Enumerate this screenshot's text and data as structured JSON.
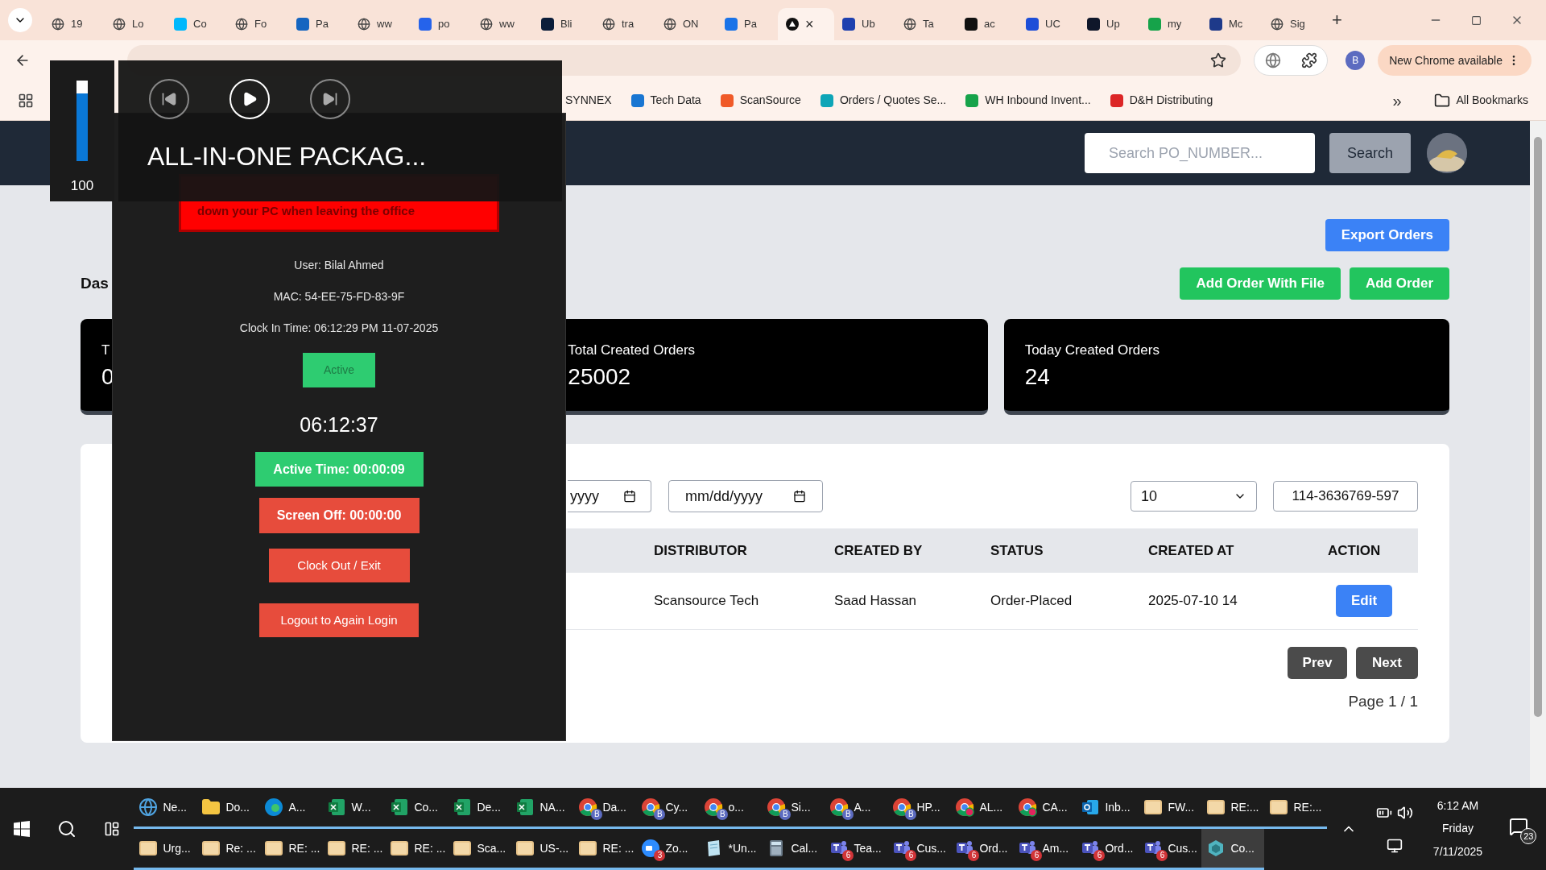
{
  "browser": {
    "tabs": [
      {
        "label": "19",
        "selected": false,
        "kind": "globe"
      },
      {
        "label": "Lo",
        "selected": false,
        "kind": "globe"
      },
      {
        "label": "Co",
        "selected": false,
        "kind": "square",
        "color": "#00b8fc"
      },
      {
        "label": "Fo",
        "selected": false,
        "kind": "globe"
      },
      {
        "label": "Pa",
        "selected": false,
        "kind": "square",
        "color": "#1565c0"
      },
      {
        "label": "ww",
        "selected": false,
        "kind": "globe"
      },
      {
        "label": "po",
        "selected": false,
        "kind": "square",
        "color": "#2563eb"
      },
      {
        "label": "ww",
        "selected": false,
        "kind": "globe"
      },
      {
        "label": "Bli",
        "selected": false,
        "kind": "square",
        "color": "#0b1d3a"
      },
      {
        "label": "tra",
        "selected": false,
        "kind": "globe"
      },
      {
        "label": "ON",
        "selected": false,
        "kind": "globe"
      },
      {
        "label": "Pa",
        "selected": false,
        "kind": "square",
        "color": "#1a73e8"
      },
      {
        "selected": true,
        "kind": "dot",
        "close": "×"
      },
      {
        "label": "Ub",
        "selected": false,
        "kind": "square",
        "color": "#1e40af"
      },
      {
        "label": "Ta",
        "selected": false,
        "kind": "globe"
      },
      {
        "label": "ac",
        "selected": false,
        "kind": "square",
        "color": "#111111"
      },
      {
        "label": "UC",
        "selected": false,
        "kind": "square",
        "color": "#1d4ed8"
      },
      {
        "label": "Up",
        "selected": false,
        "kind": "square",
        "color": "#0f172a"
      },
      {
        "label": "my",
        "selected": false,
        "kind": "square",
        "color": "#16a34a"
      },
      {
        "label": "Mc",
        "selected": false,
        "kind": "square",
        "color": "#1e3a8a"
      },
      {
        "label": "Sig",
        "selected": false,
        "kind": "globe"
      }
    ],
    "new_tab": "+",
    "profile": "B",
    "update_button": "New Chrome available",
    "bookmarks": [
      {
        "label": "SYNNEX",
        "kind": "none"
      },
      {
        "label": "Tech Data",
        "kind": "square",
        "color": "#1976d2"
      },
      {
        "label": "ScanSource",
        "kind": "square",
        "color": "#f05a28"
      },
      {
        "label": "Orders / Quotes Se...",
        "kind": "square",
        "color": "#0ea5b7"
      },
      {
        "label": "WH Inbound Invent...",
        "kind": "square",
        "color": "#16a34a"
      },
      {
        "label": "D&H Distributing",
        "kind": "square",
        "color": "#dc2626"
      }
    ],
    "more": "»",
    "all_bookmarks": "All Bookmarks"
  },
  "app": {
    "search_placeholder": "Search PO_NUMBER...",
    "search_button": "Search",
    "export_button": "Export Orders",
    "add_file_button": "Add Order With File",
    "add_button": "Add Order",
    "title": "Das",
    "cards": [
      {
        "label": "T",
        "value": "0"
      },
      {
        "label": "Total Created Orders",
        "value": "25002"
      },
      {
        "label": "Today Created Orders",
        "value": "24"
      }
    ],
    "filters": {
      "date_from": "yyyy",
      "date_to": "mm/dd/yyyy",
      "page_size": "10",
      "search_value": "114-3636769-597"
    },
    "table": {
      "columns": [
        "DISTRIBUTOR",
        "CREATED BY",
        "STATUS",
        "CREATED AT",
        "ACTION"
      ],
      "rows": [
        {
          "cells": [
            "Scansource Tech",
            "Saad Hassan",
            "Order-Placed",
            "2025-07-10 14"
          ],
          "action": "Edit"
        }
      ]
    },
    "pagination": {
      "prev": "Prev",
      "next": "Next",
      "page": "Page 1 / 1"
    }
  },
  "attendance": {
    "banner": "down your PC when leaving the office",
    "user": "User: Bilal Ahmed",
    "mac": "MAC: 54-EE-75-FD-83-9F",
    "clock_in": "Clock In Time: 06:12:29 PM 11-07-2025",
    "status": "Active",
    "time": "06:12:37",
    "active_time": "Active Time: 00:00:09",
    "screen_off": "Screen Off: 00:00:00",
    "clock_out": "Clock Out / Exit",
    "logout": "Logout to Again Login"
  },
  "media": {
    "volume": {
      "level": 1,
      "reading": "100"
    },
    "title": "ALL-IN-ONE PACKAG..."
  },
  "taskbar": {
    "rows": [
      [
        {
          "label": "Ne...",
          "kind": "globe",
          "selected": false
        },
        {
          "label": "Do...",
          "kind": "folder",
          "selected": false
        },
        {
          "label": "A...",
          "kind": "edge",
          "selected": false
        },
        {
          "label": "W...",
          "kind": "excel",
          "selected": false
        },
        {
          "label": "Co...",
          "kind": "excel",
          "selected": false
        },
        {
          "label": "De...",
          "kind": "excel",
          "selected": false
        },
        {
          "label": "NA...",
          "kind": "excel",
          "selected": false
        },
        {
          "label": "Da...",
          "kind": "chrome",
          "badge": "B",
          "selected": false
        },
        {
          "label": "Cy...",
          "kind": "chrome",
          "badge": "B",
          "selected": false
        },
        {
          "label": "o...",
          "kind": "chrome",
          "badge": "B",
          "selected": false
        },
        {
          "label": "Si...",
          "kind": "chrome",
          "badge": "B",
          "selected": false
        },
        {
          "label": "A...",
          "kind": "chrome",
          "badge": "B",
          "selected": false
        },
        {
          "label": "HP...",
          "kind": "chrome",
          "badge": "B",
          "selected": false
        },
        {
          "label": "AL...",
          "kind": "chromealert",
          "selected": false
        },
        {
          "label": "CA...",
          "kind": "chromealert",
          "selected": false
        },
        {
          "label": "Inb...",
          "kind": "outlook",
          "selected": false
        },
        {
          "label": "FW...",
          "kind": "mail",
          "selected": false
        },
        {
          "label": "RE:...",
          "kind": "mail",
          "selected": false
        },
        {
          "label": "RE:...",
          "kind": "mail",
          "selected": false
        }
      ],
      [
        {
          "label": "Urg...",
          "kind": "mail",
          "selected": false
        },
        {
          "label": "Re: ...",
          "kind": "mail",
          "selected": false
        },
        {
          "label": "RE: ...",
          "kind": "mail",
          "selected": false
        },
        {
          "label": "RE: ...",
          "kind": "mail",
          "selected": false
        },
        {
          "label": "RE: ...",
          "kind": "mail",
          "selected": false
        },
        {
          "label": "Sca...",
          "kind": "mail",
          "selected": false
        },
        {
          "label": "US-...",
          "kind": "mail",
          "selected": false
        },
        {
          "label": "RE: ...",
          "kind": "mail",
          "selected": false
        },
        {
          "label": "Zo...",
          "kind": "zoom",
          "badge": "3",
          "selected": false
        },
        {
          "label": "*Un...",
          "kind": "notepad",
          "selected": false
        },
        {
          "label": "Cal...",
          "kind": "calc",
          "selected": false
        },
        {
          "label": "Tea...",
          "kind": "teams",
          "badge": "6",
          "selected": false
        },
        {
          "label": "Cus...",
          "kind": "teams",
          "badge": "6",
          "selected": false
        },
        {
          "label": "Ord...",
          "kind": "teams",
          "badge": "6",
          "selected": false
        },
        {
          "label": "Am...",
          "kind": "teams",
          "badge": "6",
          "selected": false
        },
        {
          "label": "Ord...",
          "kind": "teams",
          "badge": "6",
          "selected": false
        },
        {
          "label": "Cus...",
          "kind": "teams",
          "badge": "6",
          "selected": false
        },
        {
          "label": "Co...",
          "kind": "app",
          "selected": true
        }
      ]
    ],
    "time": "6:12 AM",
    "day": "Friday",
    "date": "7/11/2025",
    "notifications": "23"
  }
}
